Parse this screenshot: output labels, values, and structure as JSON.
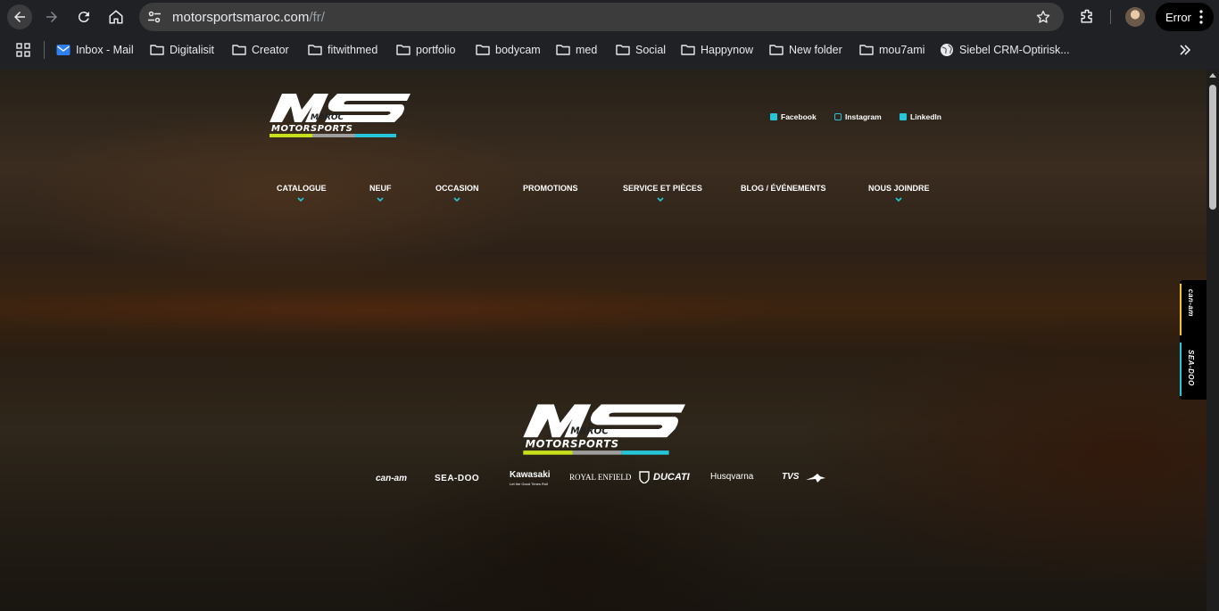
{
  "browser": {
    "url_host": "motorsportsmaroc.com",
    "url_path": "/fr/",
    "profile_button": "Error",
    "icons": [
      "back-arrow-icon",
      "forward-arrow-icon",
      "reload-icon",
      "home-icon",
      "site-settings-icon",
      "bookmark-star-icon",
      "extensions-icon",
      "avatar",
      "kebab-menu-icon",
      "apps-grid-icon",
      "more-bookmarks-icon"
    ]
  },
  "bookmarks": [
    {
      "label": "Inbox - Mail",
      "icon": "mail-icon"
    },
    {
      "label": "Digitalisit",
      "icon": "folder-icon"
    },
    {
      "label": "Creator",
      "icon": "folder-icon"
    },
    {
      "label": "fitwithmed",
      "icon": "folder-icon"
    },
    {
      "label": "portfolio",
      "icon": "folder-icon"
    },
    {
      "label": "bodycam",
      "icon": "folder-icon"
    },
    {
      "label": "med",
      "icon": "folder-icon"
    },
    {
      "label": "Social",
      "icon": "folder-icon"
    },
    {
      "label": "Happynow",
      "icon": "folder-icon"
    },
    {
      "label": "New folder",
      "icon": "folder-icon"
    },
    {
      "label": "mou7ami",
      "icon": "folder-icon"
    },
    {
      "label": "Siebel CRM-Optirisk...",
      "icon": "globe-icon"
    }
  ],
  "site": {
    "logo": {
      "top": "MAROC",
      "bottom": "MOTORSPORTS"
    },
    "socials": [
      {
        "label": "Facebook",
        "icon": "facebook-icon"
      },
      {
        "label": "Instagram",
        "icon": "instagram-icon"
      },
      {
        "label": "LinkedIn",
        "icon": "linkedin-icon"
      }
    ],
    "menu": [
      {
        "label": "CATALOGUE",
        "has_dropdown": true
      },
      {
        "label": "NEUF",
        "has_dropdown": true
      },
      {
        "label": "OCCASION",
        "has_dropdown": true
      },
      {
        "label": "PROMOTIONS",
        "has_dropdown": false
      },
      {
        "label": "SERVICE ET PIÈCES",
        "has_dropdown": true
      },
      {
        "label": "BLOG / ÉVÉNEMENTS",
        "has_dropdown": false
      },
      {
        "label": "NOUS JOINDRE",
        "has_dropdown": true
      }
    ],
    "side_tab": [
      "can-am",
      "SEA-DOO"
    ],
    "brands": [
      "can-am",
      "SEA-DOO",
      "Kawasaki",
      "Let the Good Times Roll",
      "ROYAL ENFIELD",
      "DUCATI",
      "Husqvarna",
      "TVS"
    ],
    "colors": {
      "accent_yellow": "#c6e01a",
      "accent_cyan": "#26c6da",
      "accent_gray": "#9e9e9e"
    }
  }
}
